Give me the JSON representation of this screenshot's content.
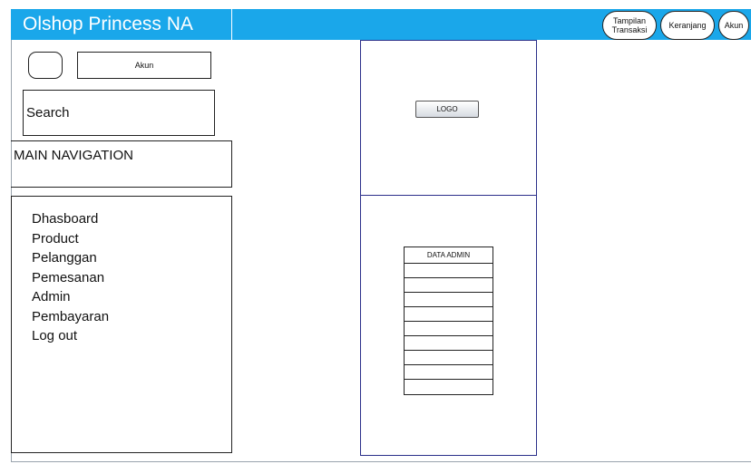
{
  "header": {
    "brand": "Olshop Princess NA",
    "buttons": {
      "transaksi": "Tampilan\nTransaksi",
      "keranjang": "Keranjang",
      "akun": "Akun"
    }
  },
  "sidebar": {
    "akun_label": "Akun",
    "search_label": "Search",
    "main_nav_title": "MAIN NAVIGATION",
    "items": [
      "Dhasboard",
      "Product",
      "Pelanggan",
      "Pemesanan",
      "Admin",
      "Pembayaran",
      "Log out"
    ]
  },
  "content": {
    "logo_label": "LOGO",
    "table_title": "DATA ADMIN",
    "table_rows": 9
  },
  "colors": {
    "header_bg": "#1aa7ea",
    "panel_border": "#2b2f8a"
  }
}
